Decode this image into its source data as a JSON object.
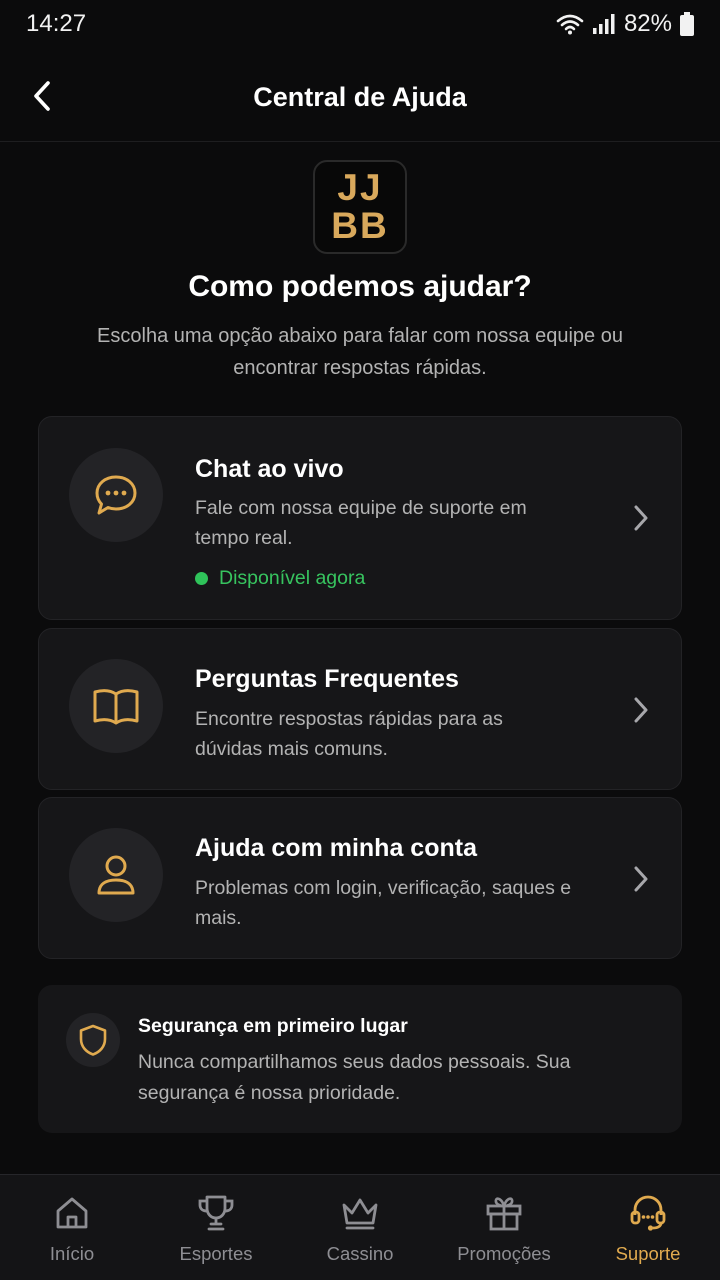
{
  "status_bar": {
    "time": "14:27",
    "battery": "82%"
  },
  "header": {
    "title": "Central de Ajuda"
  },
  "logo": {
    "line1": "JJ",
    "line2": "BB"
  },
  "intro": {
    "headline": "Como podemos ajudar?",
    "subtext": "Escolha uma opção abaixo para falar com nossa equipe ou encontrar respostas rápidas."
  },
  "cards": [
    {
      "title": "Chat ao vivo",
      "desc": "Fale com nossa equipe de suporte em tempo real.",
      "status": "Disponível agora",
      "icon": "chat-bubble-icon"
    },
    {
      "title": "Perguntas Frequentes",
      "desc": "Encontre respostas rápidas para as dúvidas mais comuns.",
      "icon": "book-icon"
    },
    {
      "title": "Ajuda com minha conta",
      "desc": "Problemas com login, verificação, saques e mais.",
      "icon": "user-icon"
    }
  ],
  "security": {
    "title": "Segurança em primeiro lugar",
    "desc": "Nunca compartilhamos seus dados pessoais. Sua segurança é nossa prioridade."
  },
  "nav": [
    {
      "label": "Início",
      "icon": "home-icon"
    },
    {
      "label": "Esportes",
      "icon": "trophy-icon"
    },
    {
      "label": "Cassino",
      "icon": "crown-icon"
    },
    {
      "label": "Promoções",
      "icon": "gift-icon"
    },
    {
      "label": "Suporte",
      "icon": "headset-icon",
      "active": true
    }
  ],
  "colors": {
    "accent": "#e0aa4f",
    "background": "#0b0b0c",
    "card": "#161618",
    "online": "#2fc35a"
  }
}
